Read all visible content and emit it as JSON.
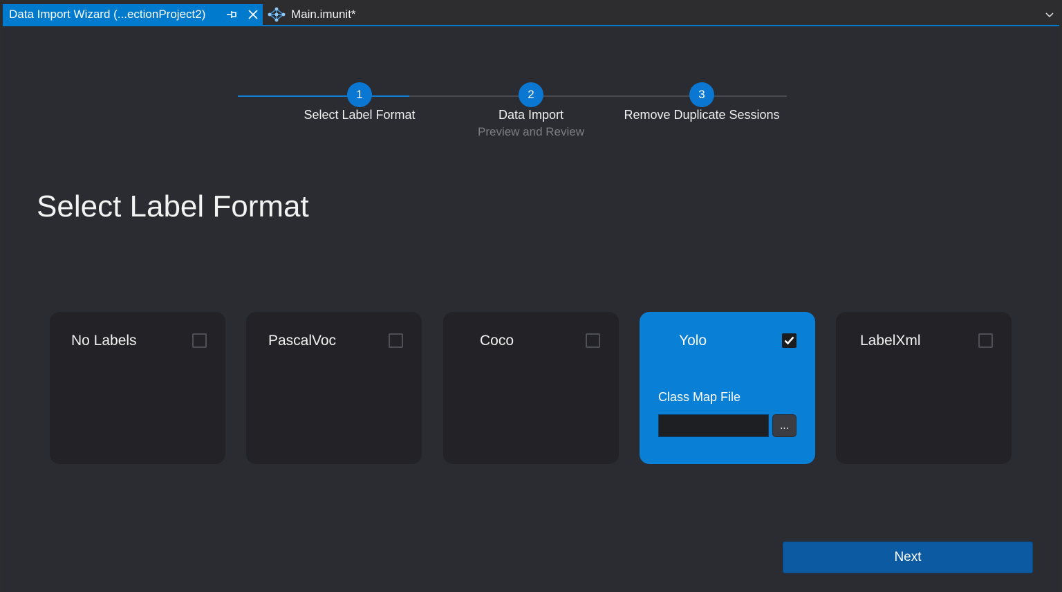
{
  "tabs": [
    {
      "title": "Data Import Wizard (...ectionProject2)",
      "active": true,
      "icons": [
        "pin-icon",
        "close-icon"
      ]
    },
    {
      "title": "Main.imunit*",
      "active": false,
      "icon": "network-diagram-icon"
    }
  ],
  "stepper": {
    "steps": [
      {
        "number": "1",
        "label": "Select Label Format",
        "sublabel": ""
      },
      {
        "number": "2",
        "label": "Data Import",
        "sublabel": "Preview and Review"
      },
      {
        "number": "3",
        "label": "Remove Duplicate Sessions",
        "sublabel": ""
      }
    ],
    "current_step": 1
  },
  "page_title": "Select Label Format",
  "formats": [
    {
      "label": "No Labels",
      "checked": false
    },
    {
      "label": "PascalVoc",
      "checked": false
    },
    {
      "label": "Coco",
      "checked": false
    },
    {
      "label": "Yolo",
      "checked": true,
      "field_label": "Class Map File",
      "field_value": "",
      "browse_label": "..."
    },
    {
      "label": "LabelXml",
      "checked": false
    }
  ],
  "next_label": "Next",
  "colors": {
    "accent": "#007acc",
    "selected_card": "#0a7fd6",
    "card": "#232327",
    "background": "#2b2c31",
    "next_button": "#0b5aa2"
  }
}
